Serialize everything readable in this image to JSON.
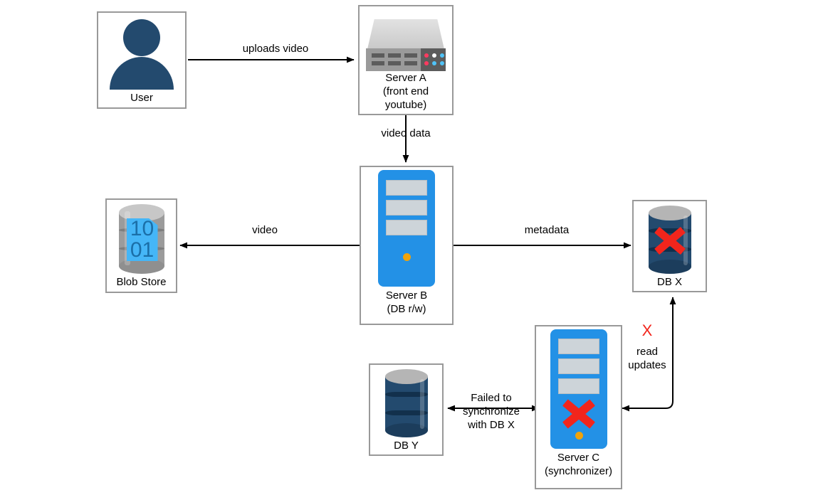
{
  "diagram": {
    "title": "Video upload pipeline with failed DB synchronization",
    "colors": {
      "box_border": "#999999",
      "canvas_bg": "#ffffff",
      "edge": "#000000",
      "user_navy": "#234a6e",
      "server_blue": "#2391e6",
      "server_bay_gray": "#cdd4d9",
      "server_dot_orange": "#f0a30a",
      "rack_gray": "#9a9a9a",
      "rack_top_gray": "#d6d6d6",
      "db_navy": "#234a6e",
      "db_cap_gray": "#b5b5b5",
      "blob_gray": "#9b9b9b",
      "blob_doc_blue": "#45b6f7",
      "error_red": "#f2251c",
      "text": "#000000"
    },
    "nodes": [
      {
        "id": "user",
        "icon": "user-avatar-icon",
        "label_lines": [
          "User"
        ]
      },
      {
        "id": "server-a",
        "icon": "rack-server-icon",
        "label_lines": [
          "Server A",
          "(front end",
          "youtube)"
        ]
      },
      {
        "id": "blob-store",
        "icon": "blob-store-icon",
        "doc_digits": [
          "10",
          "01"
        ],
        "label_lines": [
          "Blob Store"
        ]
      },
      {
        "id": "server-b",
        "icon": "tower-server-icon",
        "label_lines": [
          "Server B",
          "(DB r/w)"
        ]
      },
      {
        "id": "db-x",
        "icon": "database-icon",
        "status": "failed",
        "label_lines": [
          "DB X"
        ]
      },
      {
        "id": "db-y",
        "icon": "database-icon",
        "status": "ok",
        "label_lines": [
          "DB Y"
        ]
      },
      {
        "id": "server-c",
        "icon": "tower-server-icon",
        "status": "failed",
        "label_lines": [
          "Server C",
          "(synchronizer)"
        ]
      }
    ],
    "edges": [
      {
        "id": "user-to-server-a",
        "label": "uploads video",
        "from": "user",
        "to": "server-a",
        "direction": "forward"
      },
      {
        "id": "server-a-to-server-b",
        "label": "video data",
        "from": "server-a",
        "to": "server-b",
        "direction": "forward"
      },
      {
        "id": "server-b-to-blob-store",
        "label": "video",
        "from": "server-b",
        "to": "blob-store",
        "direction": "forward"
      },
      {
        "id": "server-b-to-db-x",
        "label": "metadata",
        "from": "server-b",
        "to": "db-x",
        "direction": "forward"
      },
      {
        "id": "db-y-to-server-c",
        "label_lines": [
          "Failed to",
          "synchronize",
          "with DB X"
        ],
        "from": "db-y",
        "to": "server-c",
        "direction": "both"
      },
      {
        "id": "server-c-to-db-x",
        "label_lines": [
          "read",
          "updates"
        ],
        "failure_marker": "X",
        "from": "server-c",
        "to": "db-x",
        "direction": "both"
      }
    ],
    "labels": {
      "uploads_video": "uploads video",
      "video_data": "video data",
      "video": "video",
      "metadata": "metadata",
      "failed_sync_l1": "Failed to",
      "failed_sync_l2": "synchronize",
      "failed_sync_l3": "with DB X",
      "read_l1": "read",
      "read_l2": "updates",
      "read_x_mark": "X"
    },
    "node_labels": {
      "user": "User",
      "server_a_l1": "Server A",
      "server_a_l2": "(front end",
      "server_a_l3": "youtube)",
      "blob_store": "Blob Store",
      "blob_digits_top": "10",
      "blob_digits_bottom": "01",
      "server_b_l1": "Server B",
      "server_b_l2": "(DB r/w)",
      "db_x": "DB X",
      "db_y": "DB Y",
      "server_c_l1": "Server C",
      "server_c_l2": "(synchronizer)"
    }
  }
}
